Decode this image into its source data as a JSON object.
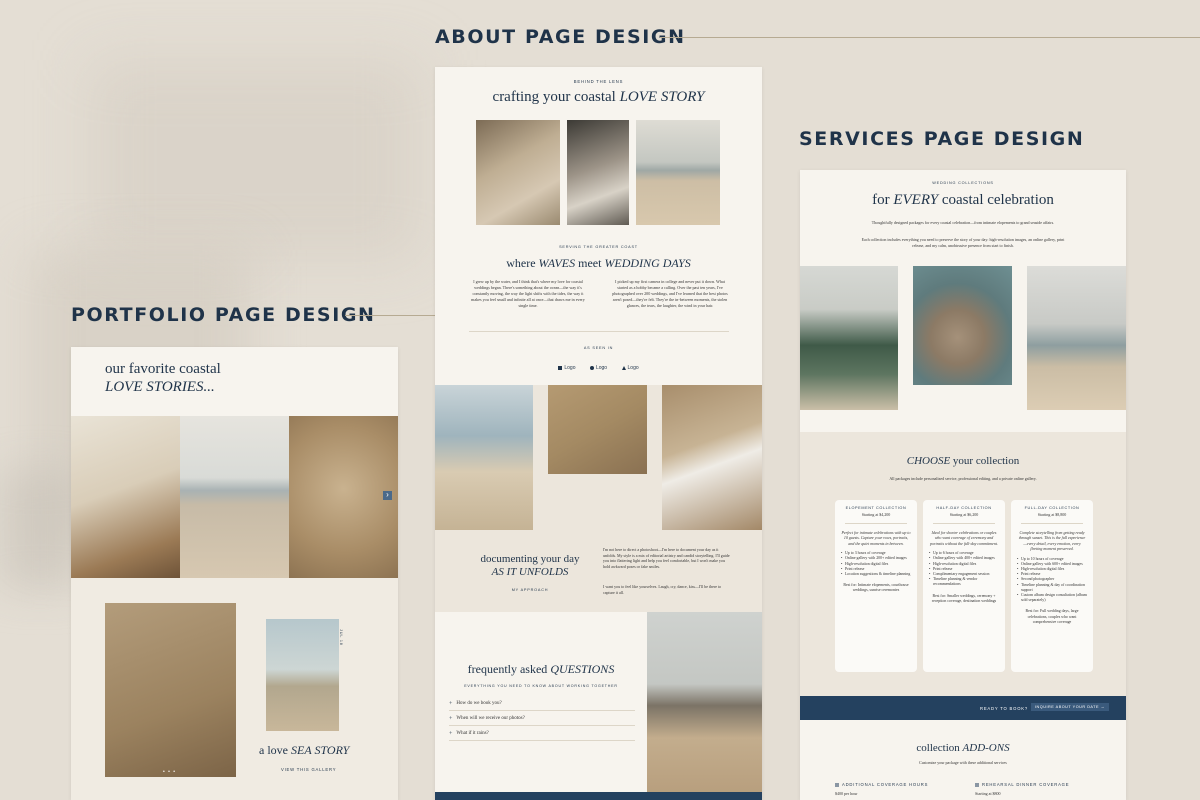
{
  "headings": {
    "about": "ABOUT PAGE DESIGN",
    "services": "SERVICES PAGE DESIGN",
    "portfolio": "PORTFOLIO PAGE DESIGN"
  },
  "portfolio": {
    "title_line1": "our favorite coastal",
    "title_line2": "LOVE STORIES...",
    "arrow": "›",
    "date_vertical": "JUL 18",
    "story_prefix": "a love ",
    "story_emph": "SEA STORY",
    "gallery_link": "VIEW THIS GALLERY",
    "dots": "• • •"
  },
  "about": {
    "kicker": "BEHIND THE LENS",
    "title_prefix": "crafting your coastal ",
    "title_emph": "LOVE STORY",
    "kicker2": "SERVING THE GREATER COAST",
    "title2_a": "where ",
    "title2_b": "WAVES",
    "title2_c": " meet ",
    "title2_d": "WEDDING DAYS",
    "para_left": "I grew up by the water, and I think that's where my love for coastal weddings began. There's something about the ocean—the way it's constantly moving, the way the light shifts with the tides, the way it makes you feel small and infinite all at once—that draws me in every single time.",
    "para_right": "I picked up my first camera in college and never put it down. What started as a hobby became a calling. Over the past ten years, I've photographed over 200 weddings, and I've learned that the best photos aren't posed—they're felt. They're the in-between moments, the stolen glances, the tears, the laughter, the wind in your hair.",
    "seen_in": "AS SEEN IN",
    "logos": [
      "Logo",
      "Logo",
      "Logo"
    ],
    "doc_line1": "documenting your day",
    "doc_line2": "AS IT UNFOLDS",
    "approach_link": "MY APPROACH",
    "doc_para1": "I'm not here to direct a photoshoot—I'm here to document your day as it unfolds. My style is a mix of editorial artistry and candid storytelling. I'll guide you into flattering light and help you feel comfortable, but I won't make you hold awkward poses or fake smiles.",
    "doc_para2": "I want you to feel like yourselves. Laugh, cry, dance, kiss—I'll be there to capture it all.",
    "faq_title_a": "frequently asked ",
    "faq_title_b": "QUESTIONS",
    "faq_sub": "EVERYTHING YOU NEED TO KNOW ABOUT WORKING TOGETHER",
    "faq": [
      "How do we book you?",
      "When will we receive our photos?",
      "What if it rains?"
    ]
  },
  "services": {
    "kicker": "WEDDING COLLECTIONS",
    "title_a": "for ",
    "title_b": "EVERY",
    "title_c": " coastal celebration",
    "intro1": "Thoughtfully designed packages for every coastal celebration—from intimate elopements to grand seaside affairs.",
    "intro2": "Each collection includes everything you need to preserve the story of your day: high-resolution images, an online gallery, print release, and my calm, unobtrusive presence from start to finish.",
    "choose_a": "CHOOSE",
    "choose_b": " your collection",
    "choose_sub": "All packages include personalized service, professional editing, and a private online gallery.",
    "cards": [
      {
        "title": "ELOPEMENT COLLECTION",
        "price": "Starting at $4,200",
        "desc": "Perfect for intimate celebrations with up to 10 guests. Capture your vows, portraits, and the quiet moments in between.",
        "items": [
          "Up to 3 hours of coverage",
          "Online gallery with 200+ edited images",
          "High-resolution digital files",
          "Print release",
          "Location suggestions & timeline planning"
        ],
        "best": "Best for: Intimate elopements, courthouse weddings, sunrise ceremonies"
      },
      {
        "title": "HALF-DAY COLLECTION",
        "price": "Starting at $6,200",
        "desc": "Ideal for shorter celebrations or couples who want coverage of ceremony and portraits without the full-day commitment.",
        "items": [
          "Up to 6 hours of coverage",
          "Online gallery with 400+ edited images",
          "High-resolution digital files",
          "Print release",
          "Complimentary engagement session",
          "Timeline planning & vendor recommendations"
        ],
        "best": "Best for: Smaller weddings, ceremony + reception coverage, destination weddings"
      },
      {
        "title": "FULL-DAY COLLECTION",
        "price": "Starting at $8,800",
        "desc": "Complete storytelling from getting ready through sunset. This is the full experience—every detail, every emotion, every fleeting moment preserved.",
        "items": [
          "Up to 10 hours of coverage",
          "Online gallery with 600+ edited images",
          "High-resolution digital files",
          "Print release",
          "Second photographer",
          "Timeline planning & day of coordination support",
          "Custom album design consultation (album sold separately)"
        ],
        "best": "Best for: Full wedding days, large celebrations, couples who want comprehensive coverage"
      }
    ],
    "ready": "READY TO BOOK?",
    "inquire": "INQUIRE ABOUT YOUR DATE →",
    "addons_a": "collection ",
    "addons_b": "ADD-ONS",
    "addons_sub": "Customize your package with these additional services",
    "addon1": "ADDITIONAL COVERAGE HOURS",
    "addon1_price": "$400 per hour",
    "addon2": "REHEARSAL DINNER COVERAGE",
    "addon2_price": "Starting at $800"
  }
}
